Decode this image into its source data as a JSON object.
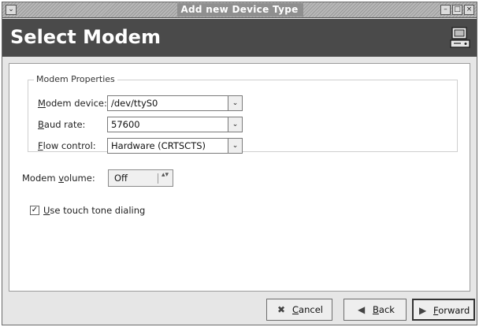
{
  "window": {
    "title": "Add new Device Type",
    "menu_glyph": "⌄",
    "minimize_glyph": "–",
    "maximize_glyph": "□",
    "close_glyph": "×"
  },
  "header": {
    "title": "Select Modem",
    "icon": "modem-icon"
  },
  "modem_properties": {
    "legend": "Modem Properties",
    "device": {
      "label_key": "M",
      "label_rest": "odem device:",
      "value": "/dev/ttyS0"
    },
    "baud": {
      "label_key": "B",
      "label_rest": "aud rate:",
      "value": "57600"
    },
    "flow": {
      "label_key": "F",
      "label_rest": "low control:",
      "value": "Hardware (CRTSCTS)"
    }
  },
  "volume": {
    "label_pre": "Modem ",
    "label_key": "v",
    "label_rest": "olume:",
    "value": "Off"
  },
  "touch_tone": {
    "checked": true,
    "check_glyph": "✓",
    "label_key": "U",
    "label_rest": "se touch tone dialing"
  },
  "buttons": {
    "cancel": {
      "icon": "✖",
      "key": "C",
      "rest": "ancel"
    },
    "back": {
      "icon": "◀",
      "key": "B",
      "rest": "ack"
    },
    "forward": {
      "icon": "▶",
      "key": "F",
      "rest": "orward"
    }
  },
  "dropdown_glyph": "⌄",
  "volume_arrow_glyph": "▴▾"
}
